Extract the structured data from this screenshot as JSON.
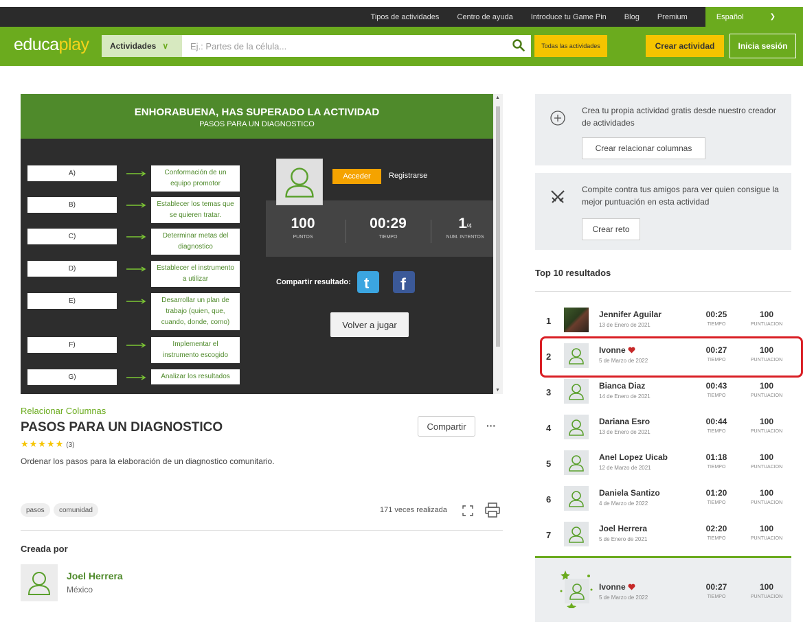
{
  "topbar": {
    "links": [
      "Tipos de actividades",
      "Centro de ayuda",
      "Introduce tu Game Pin",
      "Blog",
      "Premium"
    ],
    "language": "Español"
  },
  "nav": {
    "logo_a": "educa",
    "logo_b": "play",
    "activities_label": "Actividades",
    "search_placeholder": "Ej.: Partes de la célula...",
    "all_label": "Todas las actividades",
    "create_label": "Crear actividad",
    "login_label": "Inicia sesión"
  },
  "game": {
    "heading": "ENHORABUENA, HAS SUPERADO LA ACTIVIDAD",
    "subheading": "PASOS PARA UN DIAGNOSTICO",
    "pairs": [
      {
        "letter": "A)",
        "text": "Conformación de un equipo promotor"
      },
      {
        "letter": "B)",
        "text": "Establecer los temas que se quieren tratar."
      },
      {
        "letter": "C)",
        "text": "Determinar metas del diagnostico"
      },
      {
        "letter": "D)",
        "text": "Establecer el instrumento a utilizar"
      },
      {
        "letter": "E)",
        "text": "Desarrollar un plan de trabajo (quien, que, cuando, donde, como)"
      },
      {
        "letter": "F)",
        "text": "Implementar el instrumento escogido"
      },
      {
        "letter": "G)",
        "text": "Analizar los resultados"
      }
    ],
    "acceder": "Acceder",
    "registrarse": "Registrarse",
    "points": "100",
    "points_label": "PUNTOS",
    "time": "00:29",
    "time_label": "TIEMPO",
    "attempts": "1",
    "attempts_total": "/4",
    "attempts_label": "NUM. INTENTOS",
    "share_label": "Compartir resultado:",
    "replay_label": "Volver a jugar"
  },
  "activity": {
    "category": "Relacionar Columnas",
    "title": "PASOS PARA UN DIAGNOSTICO",
    "rating_stars": 5,
    "rating_count": "(3)",
    "description": "Ordenar los pasos para la elaboración de un diagnostico comunitario.",
    "share_button": "Compartir",
    "more": "···",
    "tags": [
      "pasos",
      "comunidad"
    ],
    "times_played": "171 veces realizada",
    "created_by_label": "Creada por",
    "author_name": "Joel Herrera",
    "author_country": "México"
  },
  "sidebar": {
    "create_text": "Crea tu propia actividad gratis desde nuestro creador de actividades",
    "create_button": "Crear relacionar columnas",
    "challenge_text": "Compite contra tus amigos para ver quien consigue la mejor puntuación en esta actividad",
    "challenge_button": "Crear reto",
    "top_title": "Top 10 resultados",
    "time_label": "TIEMPO",
    "points_label": "PUNTUACION",
    "results": [
      {
        "rank": "1",
        "name": "Jennifer Aguilar",
        "date": "13 de Enero de 2021",
        "time": "00:25",
        "points": "100",
        "heart": false,
        "photo": true
      },
      {
        "rank": "2",
        "name": "Ivonne",
        "date": "5 de Marzo de 2022",
        "time": "00:27",
        "points": "100",
        "heart": true,
        "photo": false
      },
      {
        "rank": "3",
        "name": "Bianca Diaz",
        "date": "14 de Enero de 2021",
        "time": "00:43",
        "points": "100",
        "heart": false,
        "photo": false
      },
      {
        "rank": "4",
        "name": "Dariana Esro",
        "date": "13 de Enero de 2021",
        "time": "00:44",
        "points": "100",
        "heart": false,
        "photo": false
      },
      {
        "rank": "5",
        "name": "Anel Lopez Uicab",
        "date": "12 de Marzo de 2021",
        "time": "01:18",
        "points": "100",
        "heart": false,
        "photo": false
      },
      {
        "rank": "6",
        "name": "Daniela Santizo",
        "date": "4 de Marzo de 2022",
        "time": "01:20",
        "points": "100",
        "heart": false,
        "photo": false
      },
      {
        "rank": "7",
        "name": "Joel Herrera",
        "date": "5 de Enero de 2021",
        "time": "02:20",
        "points": "100",
        "heart": false,
        "photo": false
      }
    ],
    "my_result": {
      "name": "Ivonne",
      "date": "5 de Marzo de 2022",
      "time": "00:27",
      "points": "100"
    }
  },
  "colors": {
    "brand_green": "#6bab1e",
    "accent_yellow": "#f5c400",
    "highlight_red": "#d91e24"
  }
}
